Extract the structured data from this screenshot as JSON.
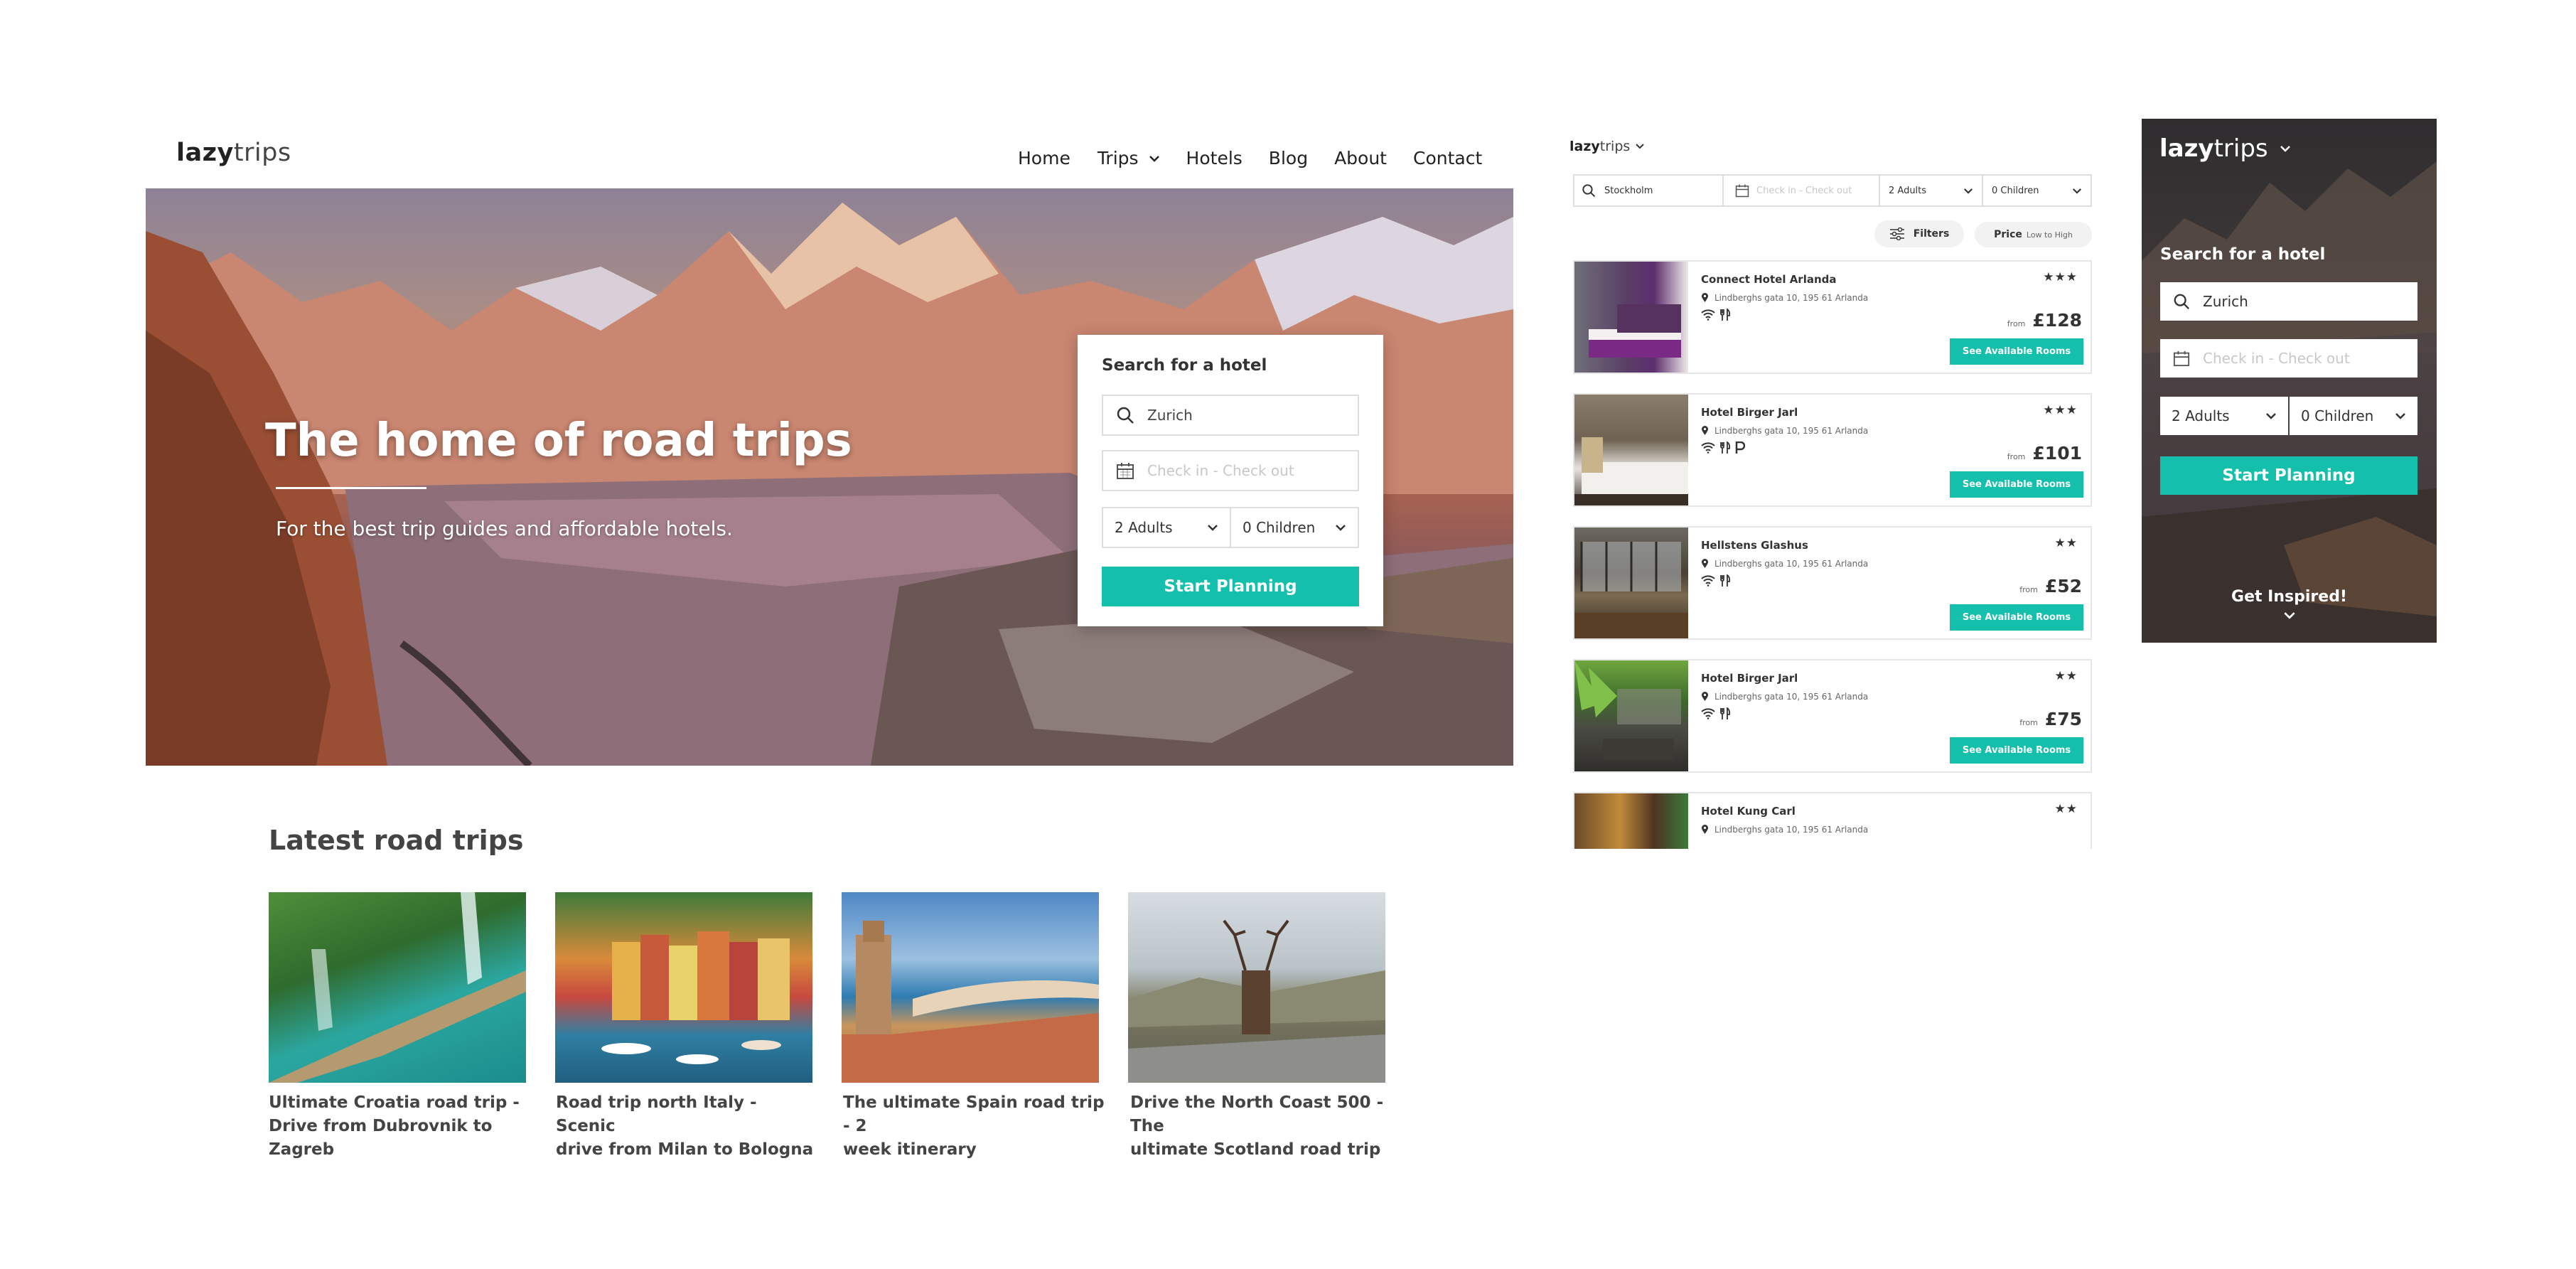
{
  "desktop": {
    "logo": {
      "bold": "lazy",
      "light": "trips"
    },
    "nav": [
      {
        "label": "Home"
      },
      {
        "label": "Trips"
      },
      {
        "label": "Hotels"
      },
      {
        "label": "Blog"
      },
      {
        "label": "About"
      },
      {
        "label": "Contact"
      }
    ],
    "hero": {
      "title": "The home of road trips",
      "subtitle": "For the best trip guides and affordable hotels."
    },
    "search": {
      "title": "Search for a hotel",
      "destination": "Zurich",
      "dates_placeholder": "Check in - Check out",
      "adults": "2 Adults",
      "children": "0 Children",
      "button": "Start Planning"
    },
    "latest": {
      "title": "Latest road trips",
      "cards": [
        {
          "title_line1": "Ultimate Croatia road trip -",
          "title_line2": "Drive from Dubrovnik to Zagreb"
        },
        {
          "title_line1": "Road trip north Italy - Scenic",
          "title_line2": "drive from Milan to Bologna"
        },
        {
          "title_line1": "The ultimate Spain road trip - 2",
          "title_line2": "week itinerary"
        },
        {
          "title_line1": "Drive the North Coast 500 - The",
          "title_line2": "ultimate Scotland road trip"
        }
      ]
    }
  },
  "hotels_view": {
    "logo": {
      "bold": "lazy",
      "light": "trips"
    },
    "search": {
      "destination": "Stockholm",
      "dates_placeholder": "Check in - Check out",
      "adults": "2 Adults",
      "children": "0 Children"
    },
    "filters_label": "Filters",
    "sort": {
      "label": "Price",
      "value": "Low to High"
    },
    "hotels": [
      {
        "name": "Connect Hotel Arlanda",
        "address": "Lindberghs gata 10, 195 61  Arlanda",
        "stars": "★★★",
        "from": "from",
        "price": "£128",
        "button": "See Available Rooms",
        "amenities": [
          "wifi-icon",
          "restaurant-icon"
        ]
      },
      {
        "name": "Hotel Birger Jarl",
        "address": "Lindberghs gata 10, 195 61  Arlanda",
        "stars": "★★★",
        "from": "from",
        "price": "£101",
        "button": "See Available Rooms",
        "amenities": [
          "wifi-icon",
          "restaurant-icon",
          "parking-icon"
        ]
      },
      {
        "name": "Hellstens Glashus",
        "address": "Lindberghs gata 10, 195 61  Arlanda",
        "stars": "★★",
        "from": "from",
        "price": "£52",
        "button": "See Available Rooms",
        "amenities": [
          "wifi-icon",
          "restaurant-icon"
        ]
      },
      {
        "name": "Hotel Birger Jarl",
        "address": "Lindberghs gata 10, 195 61  Arlanda",
        "stars": "★★",
        "from": "from",
        "price": "£75",
        "button": "See Available Rooms",
        "amenities": [
          "wifi-icon",
          "restaurant-icon"
        ]
      },
      {
        "name": "Hotel Kung Carl",
        "address": "Lindberghs gata 10, 195 61  Arlanda",
        "stars": "★★"
      }
    ]
  },
  "mobile": {
    "logo": {
      "bold": "lazy",
      "light": "trips"
    },
    "search_title": "Search for a hotel",
    "destination": "Zurich",
    "dates_placeholder": "Check in - Check out",
    "adults": "2 Adults",
    "children": "0 Children",
    "button": "Start Planning",
    "inspired": "Get Inspired!"
  },
  "colors": {
    "accent": "#14bfac",
    "text": "#333333"
  }
}
